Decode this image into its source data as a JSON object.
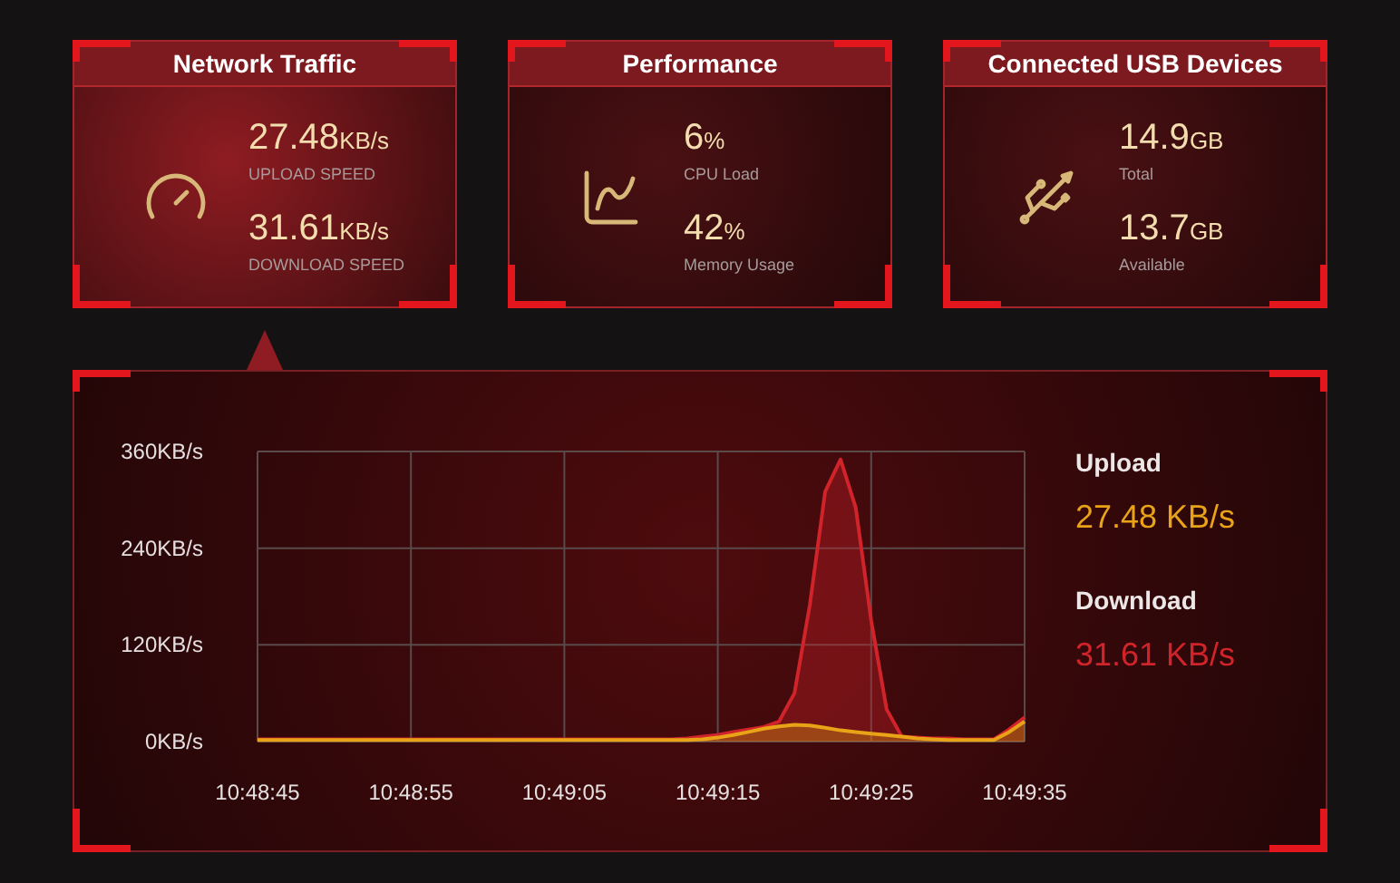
{
  "cards": [
    {
      "title": "Network Traffic",
      "selected": true,
      "stats": [
        {
          "value": "27.48",
          "unit": "KB/s",
          "label": "UPLOAD SPEED"
        },
        {
          "value": "31.61",
          "unit": "KB/s",
          "label": "DOWNLOAD SPEED"
        }
      ]
    },
    {
      "title": "Performance",
      "selected": false,
      "stats": [
        {
          "value": "6",
          "unit": "%",
          "label": "CPU Load"
        },
        {
          "value": "42",
          "unit": "%",
          "label": "Memory Usage"
        }
      ]
    },
    {
      "title": "Connected USB Devices",
      "selected": false,
      "stats": [
        {
          "value": "14.9",
          "unit": "GB",
          "label": "Total"
        },
        {
          "value": "13.7",
          "unit": "GB",
          "label": "Available"
        }
      ]
    }
  ],
  "traffic": {
    "readings": [
      "27.48 KB/s",
      "31.61 KB/s"
    ],
    "chart_data": {
      "type": "area",
      "categories": [
        "10:48:45",
        null,
        null,
        null,
        null,
        null,
        null,
        null,
        null,
        null,
        "10:48:55",
        null,
        null,
        null,
        null,
        null,
        null,
        null,
        null,
        null,
        "10:49:05",
        null,
        null,
        null,
        null,
        null,
        null,
        null,
        null,
        null,
        "10:49:15",
        null,
        null,
        null,
        null,
        null,
        null,
        null,
        null,
        null,
        "10:49:25",
        null,
        null,
        null,
        null,
        null,
        null,
        null,
        null,
        null,
        "10:49:35"
      ],
      "series": [
        {
          "name": "Upload",
          "color": "#e8a317",
          "values": [
            2,
            2,
            2,
            2,
            2,
            2,
            2,
            2,
            2,
            2,
            2,
            2,
            2,
            2,
            2,
            2,
            2,
            2,
            2,
            2,
            2,
            2,
            2,
            2,
            2,
            2,
            2,
            2,
            2,
            3,
            5,
            8,
            12,
            16,
            19,
            21,
            20,
            17,
            14,
            12,
            10,
            8,
            6,
            4,
            3,
            2,
            2,
            2,
            2,
            12,
            25
          ]
        },
        {
          "name": "Download",
          "color": "#d1232a",
          "values": [
            3,
            3,
            3,
            3,
            3,
            3,
            3,
            3,
            3,
            3,
            3,
            3,
            3,
            3,
            3,
            3,
            3,
            3,
            3,
            3,
            3,
            3,
            3,
            3,
            3,
            3,
            3,
            3,
            4,
            6,
            8,
            12,
            15,
            18,
            25,
            60,
            170,
            310,
            350,
            290,
            150,
            40,
            6,
            5,
            4,
            4,
            3,
            3,
            3,
            15,
            30
          ]
        }
      ],
      "ylim": [
        0,
        360
      ],
      "grid": true,
      "yticks": [
        {
          "value": 0,
          "label": "0KB/s"
        },
        {
          "value": 120,
          "label": "120KB/s"
        },
        {
          "value": 240,
          "label": "240KB/s"
        },
        {
          "value": 360,
          "label": "360KB/s"
        }
      ]
    }
  }
}
